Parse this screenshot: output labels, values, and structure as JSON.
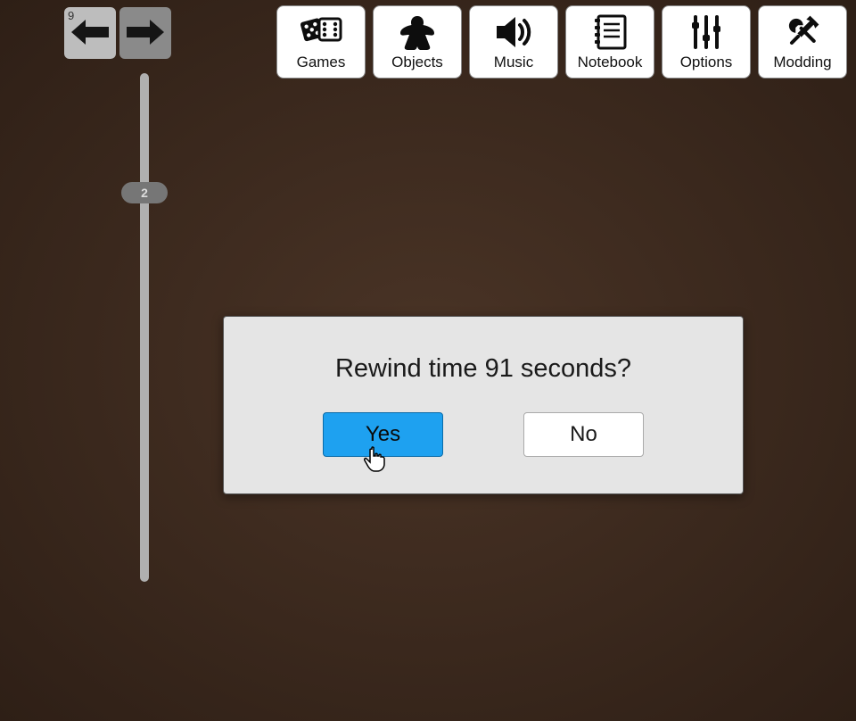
{
  "history": {
    "undo_count": "9",
    "slider_value": "2"
  },
  "toolbar": {
    "games": "Games",
    "objects": "Objects",
    "music": "Music",
    "notebook": "Notebook",
    "options": "Options",
    "modding": "Modding"
  },
  "dialog": {
    "message": "Rewind time 91 seconds?",
    "yes": "Yes",
    "no": "No"
  }
}
